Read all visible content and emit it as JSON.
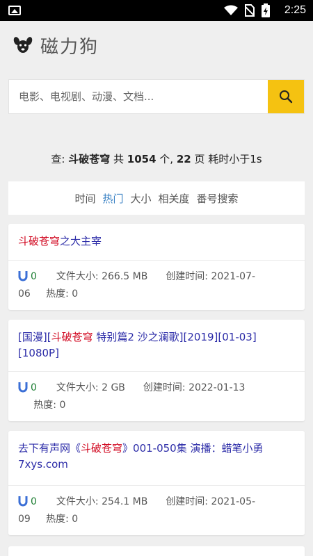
{
  "status_bar": {
    "time": "2:25"
  },
  "app": {
    "title": "磁力狗"
  },
  "search": {
    "placeholder": "电影、电视剧、动漫、文档..."
  },
  "summary": {
    "prefix": "查: ",
    "query": "斗破苍穹",
    "mid1": " 共 ",
    "count": "1054",
    "mid2": " 个, ",
    "pages": "22",
    "mid3": " 页 耗时小于1s"
  },
  "sort_tabs": [
    {
      "label": "时间",
      "active": false
    },
    {
      "label": "热门",
      "active": true
    },
    {
      "label": "大小",
      "active": false
    },
    {
      "label": "相关度",
      "active": false
    },
    {
      "label": "番号搜索",
      "active": false
    }
  ],
  "results": [
    {
      "title_prefix": "",
      "title_highlight": "斗破苍穹",
      "title_suffix": "之大主宰",
      "seeds": "0",
      "size_label": "文件大小:",
      "size": "266.5 MB",
      "created_label": "创建时间:",
      "created_part1": "2021-07-",
      "created_part2": "06",
      "heat_label": "热度:",
      "heat": "0"
    },
    {
      "title_prefix": "[国漫][",
      "title_highlight": "斗破苍穹",
      "title_suffix": " 特别篇2 沙之澜歌][2019][01-03][1080P]",
      "seeds": "0",
      "size_label": "文件大小:",
      "size": "2 GB",
      "created_label": "创建时间:",
      "created_part1": "2022-01-13",
      "created_part2": "",
      "heat_label": "热度:",
      "heat": "0"
    },
    {
      "title_prefix": "去下有声网《",
      "title_highlight": "斗破苍穹",
      "title_suffix": "》001-050集 演播：蜡笔小勇 7xys.com",
      "seeds": "0",
      "size_label": "文件大小:",
      "size": "254.1 MB",
      "created_label": "创建时间:",
      "created_part1": "2021-05-",
      "created_part2": "09",
      "heat_label": "热度:",
      "heat": "0"
    }
  ],
  "colors": {
    "accent_yellow": "#f5c211",
    "title_blue": "#2c2ca8",
    "highlight_red": "#d0021b",
    "active_tab_blue": "#3b82c4",
    "seed_green": "#1e7e34"
  }
}
